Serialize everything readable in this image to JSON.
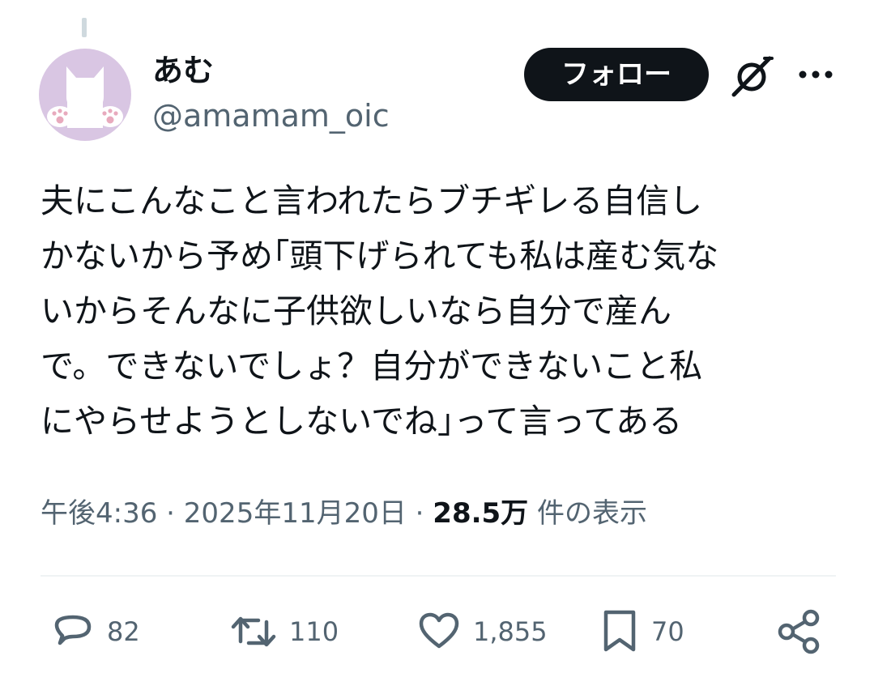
{
  "author": {
    "display_name": "あむ",
    "handle": "@amamam_oic",
    "avatar_icon": "cat-avatar-icon"
  },
  "header": {
    "follow_label": "フォロー",
    "grok_icon": "grok-icon",
    "more_icon": "more-icon"
  },
  "tweet": {
    "lines": [
      "夫にこんなこと言われたらブチギレる自信し",
      "かないから予め｢頭下げられても私は産む気な",
      "いからそんなに子供欲しいなら自分で産ん",
      "で。できないでしょ？自分ができないこと私",
      "にやらせようとしないでね｣って言ってある"
    ]
  },
  "meta": {
    "time": "午後4:36",
    "separator": "·",
    "date": "2025年11月20日",
    "views_count": "28.5万",
    "views_label": "件の表示"
  },
  "actions": {
    "reply_count": "82",
    "retweet_count": "110",
    "like_count": "1,855",
    "bookmark_count": "70"
  },
  "colors": {
    "text": "#0f1419",
    "secondary": "#536471",
    "avatar_bg": "#d9c6e3",
    "button_bg": "#0f1419",
    "divider": "#eff3f4"
  }
}
